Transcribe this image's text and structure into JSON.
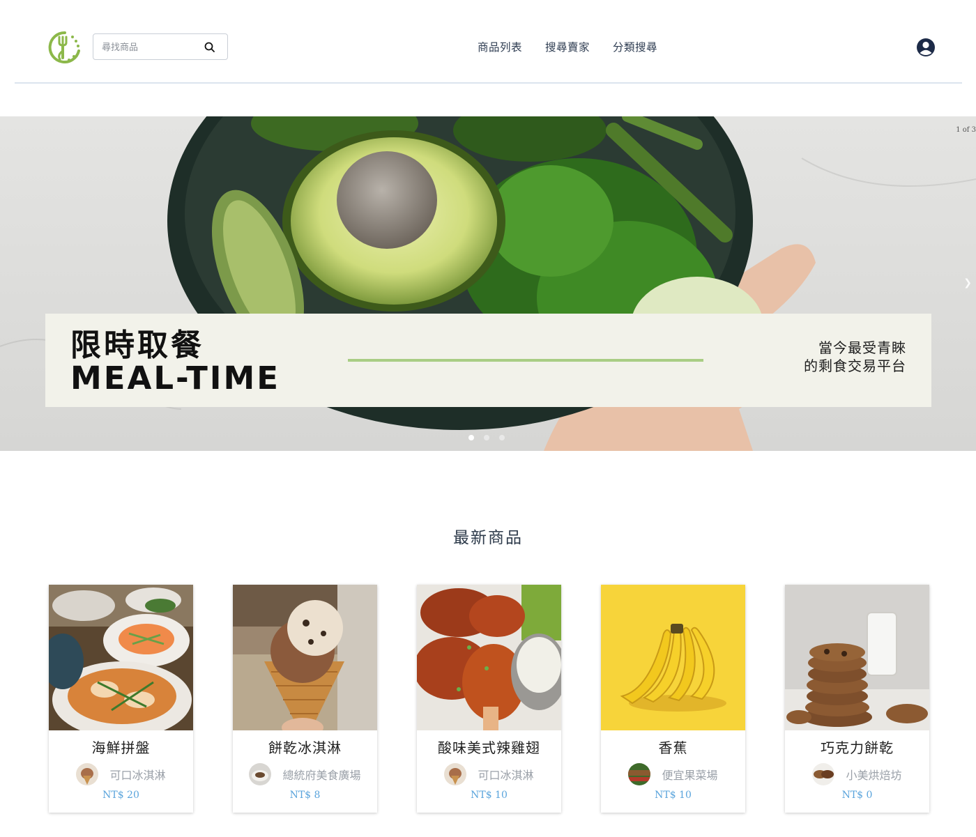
{
  "search": {
    "placeholder": "尋找商品"
  },
  "nav": [
    {
      "label": "商品列表"
    },
    {
      "label": "搜尋賣家"
    },
    {
      "label": "分類搜尋"
    }
  ],
  "hero": {
    "counter": "1 of 3",
    "title_cn": "限時取餐",
    "title_en": "MEAL-TIME",
    "tagline_1": "當今最受青睞",
    "tagline_2": "的剩食交易平台",
    "active_slide": 1,
    "slide_count": 3
  },
  "products": {
    "heading": "最新商品",
    "items": [
      {
        "name": "海鮮拼盤",
        "seller": "可口冰淇淋",
        "price": "NT$ 20"
      },
      {
        "name": "餅乾冰淇淋",
        "seller": "總統府美食廣場",
        "price": "NT$ 8"
      },
      {
        "name": "酸味美式辣雞翅",
        "seller": "可口冰淇淋",
        "price": "NT$ 10"
      },
      {
        "name": "香蕉",
        "seller": "便宜果菜場",
        "price": "NT$ 10"
      },
      {
        "name": "巧克力餅乾",
        "seller": "小美烘焙坊",
        "price": "NT$ 0"
      }
    ]
  },
  "colors": {
    "accent_green": "#a9cd84",
    "price_blue": "#5aa4dc",
    "nav_text": "#2f3d52"
  }
}
